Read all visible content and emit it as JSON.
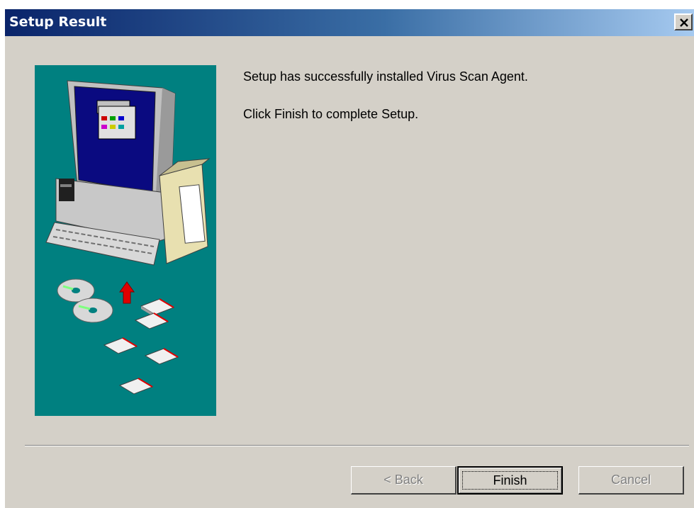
{
  "window": {
    "title": "Setup Result"
  },
  "message": {
    "line1": "Setup has successfully installed Virus Scan Agent.",
    "line2": "Click Finish to complete Setup."
  },
  "buttons": {
    "back_label": "< Back",
    "finish_label": "Finish",
    "cancel_label": "Cancel"
  },
  "colors": {
    "title_gradient_start": "#0a246a",
    "title_gradient_end": "#a6caf0",
    "dialog_background": "#d4d0c8",
    "art_background": "#008080"
  },
  "icons": [
    "close-icon",
    "computer-illustration",
    "cd-icon",
    "floppy-disk-icon",
    "red-arrow-icon"
  ]
}
